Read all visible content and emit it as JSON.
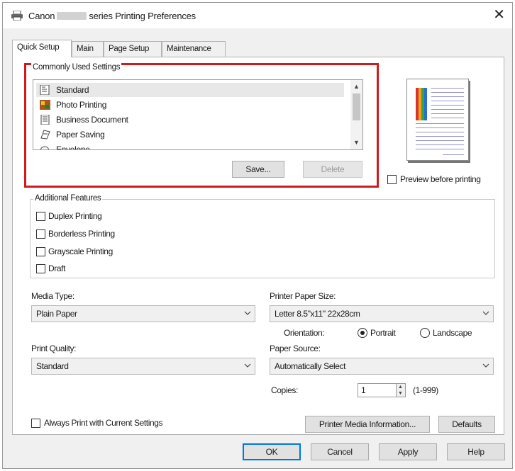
{
  "window": {
    "title_prefix": "Canon",
    "title_suffix": "series Printing Preferences",
    "close_glyph": "✕"
  },
  "tabs": [
    "Quick Setup",
    "Main",
    "Page Setup",
    "Maintenance"
  ],
  "commonly_used": {
    "label": "Commonly Used Settings",
    "items": [
      "Standard",
      "Photo Printing",
      "Business Document",
      "Paper Saving",
      "Envelope"
    ],
    "selected": "Standard",
    "save_label": "Save...",
    "delete_label": "Delete"
  },
  "preview": {
    "checkbox_label": "Preview before printing",
    "checked": false
  },
  "additional_features": {
    "label": "Additional Features",
    "items": [
      {
        "label": "Duplex Printing",
        "checked": false
      },
      {
        "label": "Borderless Printing",
        "checked": false
      },
      {
        "label": "Grayscale Printing",
        "checked": false
      },
      {
        "label": "Draft",
        "checked": false
      }
    ]
  },
  "media_type": {
    "label": "Media Type:",
    "value": "Plain Paper"
  },
  "paper_size": {
    "label": "Printer Paper Size:",
    "value": "Letter 8.5\"x11\" 22x28cm"
  },
  "orientation": {
    "label": "Orientation:",
    "portrait": "Portrait",
    "landscape": "Landscape",
    "selected": "Portrait"
  },
  "print_quality": {
    "label": "Print Quality:",
    "value": "Standard"
  },
  "paper_source": {
    "label": "Paper Source:",
    "value": "Automatically Select"
  },
  "copies": {
    "label": "Copies:",
    "value": "1",
    "range": "(1-999)"
  },
  "always_print": {
    "label": "Always Print with Current Settings",
    "checked": false
  },
  "panel_buttons": {
    "media_info": "Printer Media Information...",
    "defaults": "Defaults"
  },
  "dialog_buttons": {
    "ok": "OK",
    "cancel": "Cancel",
    "apply": "Apply",
    "help": "Help"
  },
  "colors": {
    "highlight_border": "#d11a1a",
    "default_button_border": "#0078d7"
  }
}
